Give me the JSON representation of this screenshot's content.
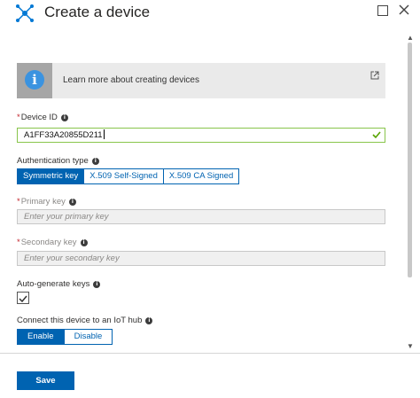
{
  "header": {
    "title": "Create a device",
    "app_icon": "iot-hub-icon",
    "maximize_icon": "maximize-icon",
    "close_icon": "close-icon"
  },
  "banner": {
    "text": "Learn more about creating devices",
    "icon": "info-icon",
    "external_icon": "external-link-icon"
  },
  "device_id": {
    "label": "Device ID",
    "value": "A1FF33A20855D211",
    "required_mark": "*"
  },
  "auth": {
    "label": "Authentication type",
    "options": [
      "Symmetric key",
      "X.509 Self-Signed",
      "X.509 CA Signed"
    ],
    "selected": "Symmetric key"
  },
  "primary_key": {
    "label": "Primary key",
    "required_mark": "*",
    "placeholder": "Enter your primary key"
  },
  "secondary_key": {
    "label": "Secondary key",
    "required_mark": "*",
    "placeholder": "Enter your secondary key"
  },
  "auto_generate": {
    "label": "Auto-generate keys",
    "checked": true
  },
  "connect": {
    "label": "Connect this device to an IoT hub",
    "options": [
      "Enable",
      "Disable"
    ],
    "selected": "Enable"
  },
  "footer": {
    "save_label": "Save"
  },
  "colors": {
    "accent": "#0063b1",
    "valid": "#88c54b",
    "required": "#c4262e",
    "info_blue": "#3b93e0"
  }
}
